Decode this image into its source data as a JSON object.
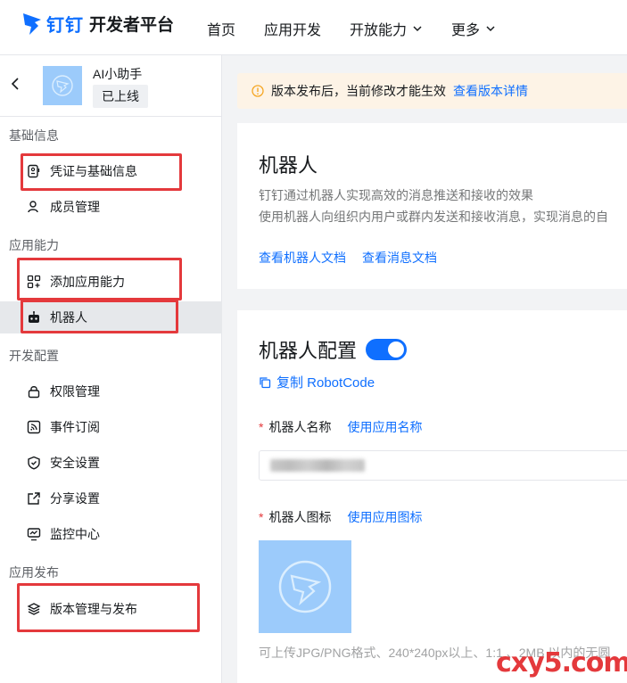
{
  "header": {
    "brand": "钉钉",
    "title": "开发者平台",
    "nav": [
      {
        "label": "首页"
      },
      {
        "label": "应用开发"
      },
      {
        "label": "开放能力"
      },
      {
        "label": "更多"
      }
    ]
  },
  "app": {
    "name": "AI小助手",
    "status": "已上线"
  },
  "sidebar": {
    "groups": [
      {
        "title": "基础信息",
        "items": [
          {
            "label": "凭证与基础信息"
          },
          {
            "label": "成员管理"
          }
        ]
      },
      {
        "title": "应用能力",
        "items": [
          {
            "label": "添加应用能力"
          },
          {
            "label": "机器人"
          }
        ]
      },
      {
        "title": "开发配置",
        "items": [
          {
            "label": "权限管理"
          },
          {
            "label": "事件订阅"
          },
          {
            "label": "安全设置"
          },
          {
            "label": "分享设置"
          },
          {
            "label": "监控中心"
          }
        ]
      },
      {
        "title": "应用发布",
        "items": [
          {
            "label": "版本管理与发布"
          }
        ]
      }
    ]
  },
  "notice": {
    "text": "版本发布后，当前修改才能生效",
    "link": "查看版本详情"
  },
  "robot_card": {
    "title": "机器人",
    "desc1": "钉钉通过机器人实现高效的消息推送和接收的效果",
    "desc2": "使用机器人向组织内用户或群内发送和接收消息，实现消息的自",
    "link1": "查看机器人文档",
    "link2": "查看消息文档"
  },
  "config_card": {
    "title": "机器人配置",
    "toggle_on": true,
    "copy_label": "复制 RobotCode",
    "name_label": "机器人名称",
    "name_link": "使用应用名称",
    "icon_label": "机器人图标",
    "icon_link": "使用应用图标",
    "hint": "可上传JPG/PNG格式、240*240px以上、1:1 、2MB 以内的无圆"
  },
  "watermark": "cxy5.com",
  "colors": {
    "accent": "#0f6fff",
    "highlight_box": "#e4393c",
    "notice_bg": "#fdf3e6",
    "icon_bg": "#9ccbfb"
  }
}
